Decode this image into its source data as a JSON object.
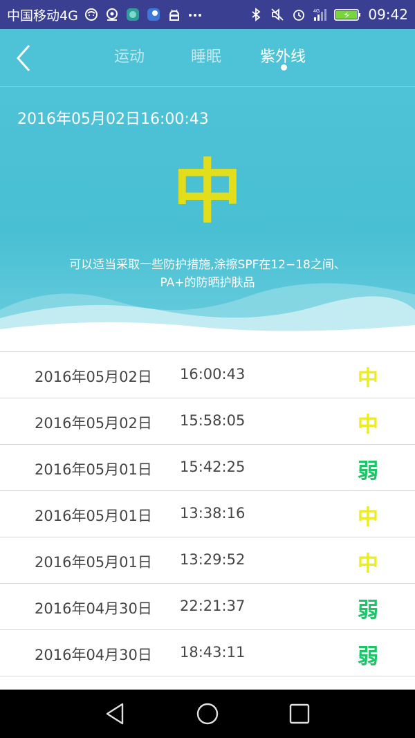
{
  "status_bar": {
    "carrier": "中国移动4G",
    "network": "4G",
    "time": "09:42"
  },
  "tabs": [
    {
      "label": "运动",
      "active": false
    },
    {
      "label": "睡眠",
      "active": false
    },
    {
      "label": "紫外线",
      "active": true
    }
  ],
  "current": {
    "datetime": "2016年05月02日16:00:43",
    "level": "中",
    "advice_line1": "可以适当采取一些防护措施,涂擦SPF在12−18之间、",
    "advice_line2": "PA+的防晒护肤品"
  },
  "history": [
    {
      "date": "2016年05月02日",
      "time": "16:00:43",
      "level": "中"
    },
    {
      "date": "2016年05月02日",
      "time": "15:58:05",
      "level": "中"
    },
    {
      "date": "2016年05月01日",
      "time": "15:42:25",
      "level": "弱"
    },
    {
      "date": "2016年05月01日",
      "time": "13:38:16",
      "level": "中"
    },
    {
      "date": "2016年05月01日",
      "time": "13:29:52",
      "level": "中"
    },
    {
      "date": "2016年04月30日",
      "time": "22:21:37",
      "level": "弱"
    },
    {
      "date": "2016年04月30日",
      "time": "18:43:11",
      "level": "弱"
    }
  ],
  "colors": {
    "header_bg": "#4ec2d6",
    "level_medium": "#ecec22",
    "level_weak": "#1fc468",
    "hero_level": "#e2de1c"
  },
  "icons": {
    "back": "chevron-left-icon",
    "nav_back": "triangle-back-icon",
    "nav_home": "circle-home-icon",
    "nav_recent": "square-recent-icon"
  }
}
